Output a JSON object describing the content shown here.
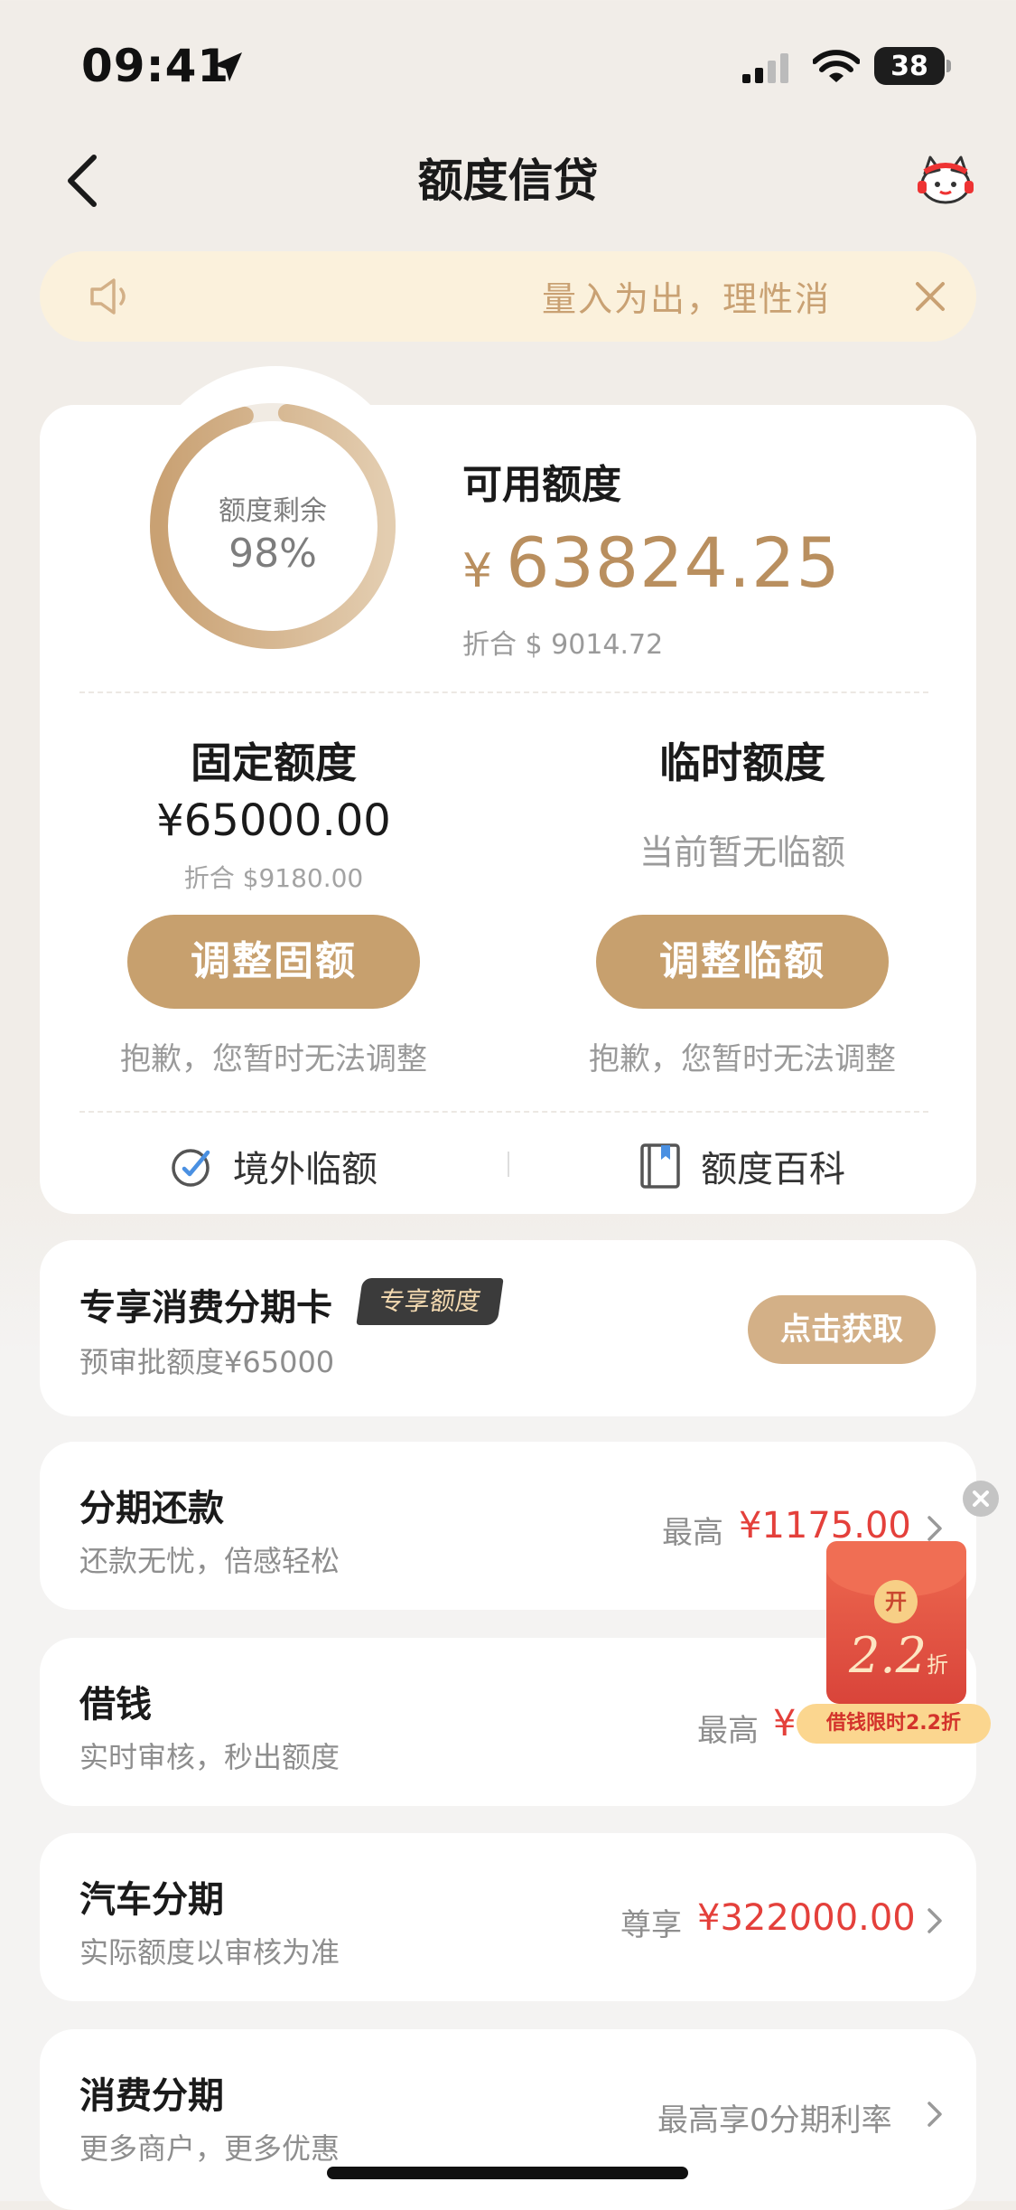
{
  "status_bar": {
    "time": "09:41",
    "battery": "38"
  },
  "nav": {
    "title": "额度信贷"
  },
  "notice": {
    "text": "量入为出，理性消"
  },
  "quota": {
    "ring_label": "额度剩余",
    "ring_percent_text": "98%",
    "ring_fraction": 0.98,
    "available_label": "可用额度",
    "available_symbol": "¥",
    "available_amount": "63824.25",
    "available_converted": "折合 $ 9014.72",
    "fixed": {
      "title": "固定额度",
      "amount": "¥65000.00",
      "converted": "折合 $9180.00",
      "button": "调整固额",
      "note": "抱歉，您暂时无法调整"
    },
    "temporary": {
      "title": "临时额度",
      "status": "当前暂无临额",
      "button": "调整临额",
      "note": "抱歉，您暂时无法调整"
    },
    "links": {
      "overseas": "境外临额",
      "wiki": "额度百科"
    }
  },
  "promo": {
    "title": "专享消费分期卡",
    "badge": "专享额度",
    "subtitle": "预审批额度¥65000",
    "button": "点击获取"
  },
  "products": [
    {
      "title": "分期还款",
      "subtitle": "还款无忧，倍感轻松",
      "prefix": "最高",
      "value": "¥1175.00"
    },
    {
      "title": "借钱",
      "subtitle": "实时审核，秒出额度",
      "prefix": "最高",
      "value": "¥"
    },
    {
      "title": "汽车分期",
      "subtitle": "实际额度以审核为准",
      "prefix": "尊享",
      "value": "¥322000.00"
    },
    {
      "title": "消费分期",
      "subtitle": "更多商户，更多优惠",
      "prefix": "最高享0分期利率",
      "value": ""
    }
  ],
  "float_packet": {
    "coin": "开",
    "number": "2.2",
    "unit": "折",
    "tag": "借钱限时2.2折"
  },
  "colors": {
    "gold": "#c7a06e",
    "gold_text": "#b98f5f",
    "red": "#e4403b",
    "notice_bg": "#fbf1dc"
  }
}
